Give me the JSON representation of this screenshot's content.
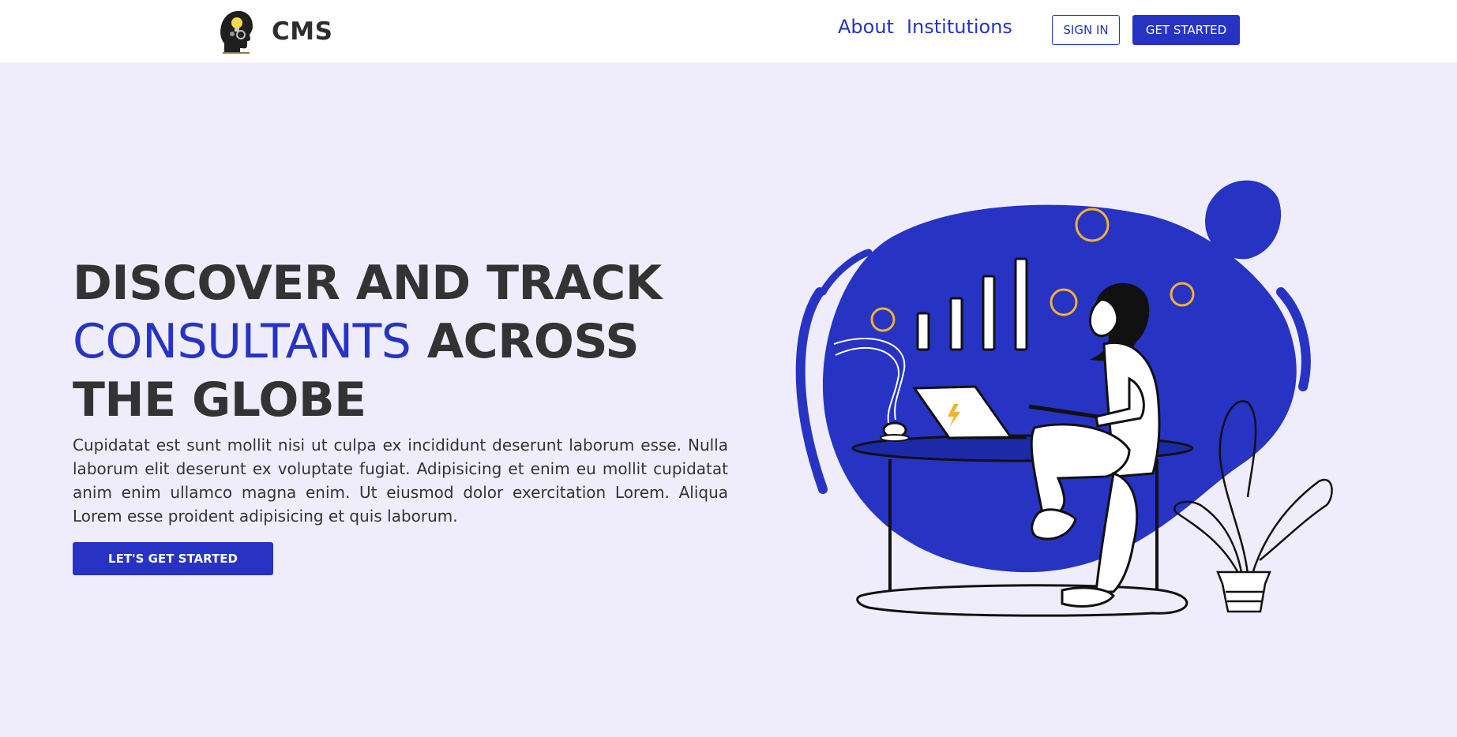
{
  "brand": {
    "name": "CMS",
    "logo_icon": "head-lightbulb-logo-icon"
  },
  "nav": {
    "links": [
      "About",
      "Institutions"
    ],
    "signin_label": "SIGN IN",
    "getstarted_label": "GET STARTED"
  },
  "hero": {
    "headline_part1": "DISCOVER AND TRACK",
    "headline_accent": "CONSULTANTS",
    "headline_part2": "ACROSS THE GLOBE",
    "description": "Cupidatat est sunt mollit nisi ut culpa ex incididunt deserunt laborum esse. Nulla laborum elit deserunt ex voluptate fugiat. Adipisicing et enim eu mollit cupidatat anim enim ullamco magna enim. Ut eiusmod dolor exercitation Lorem. Aliqua Lorem esse proident adipisicing et quis laborum.",
    "cta_label": "LET'S GET STARTED",
    "illustration": "woman-at-desk-with-laptop-and-growth-chart-illustration"
  },
  "colors": {
    "accent": "#2733c2",
    "hero_background": "#efedfc",
    "text": "#333333",
    "coin": "#f2b233"
  }
}
